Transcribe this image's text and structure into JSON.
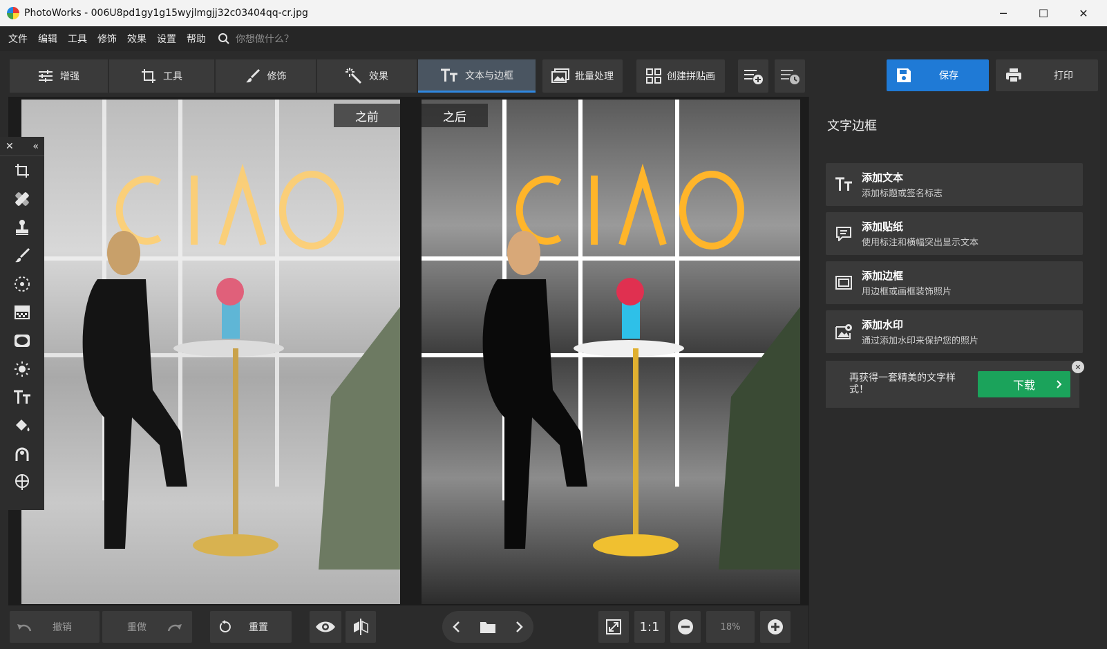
{
  "window": {
    "title": "PhotoWorks - 006U8pd1gy1g15wyjlmgjj32c03404qq-cr.jpg",
    "minimize": "─",
    "maximize": "☐",
    "close": "✕"
  },
  "menu": {
    "items": [
      "文件",
      "编辑",
      "工具",
      "修饰",
      "效果",
      "设置",
      "帮助"
    ],
    "search_placeholder": "你想做什么？"
  },
  "tabs": [
    {
      "label": "增强",
      "icon": "sliders-icon"
    },
    {
      "label": "工具",
      "icon": "crop-icon"
    },
    {
      "label": "修饰",
      "icon": "brush-icon"
    },
    {
      "label": "效果",
      "icon": "magic-wand-icon"
    },
    {
      "label": "文本与边框",
      "icon": "text-icon",
      "active": true
    }
  ],
  "toolbar": {
    "batch_label": "批量处理",
    "collage_label": "创建拼贴画",
    "save_label": "保存",
    "print_label": "打印"
  },
  "canvas": {
    "before_label": "之前",
    "after_label": "之后"
  },
  "tool_panel": {
    "close": "✕",
    "collapse": "«",
    "tools": [
      "crop-rotate-icon",
      "healing-icon",
      "clone-stamp-icon",
      "brush-icon",
      "radial-icon",
      "gradient-icon",
      "vignette-icon",
      "light-icon",
      "text-icon",
      "fill-icon",
      "curves-icon",
      "geo-icon"
    ]
  },
  "bottom": {
    "undo_label": "撤销",
    "redo_label": "重做",
    "reset_label": "重置",
    "one_to_one": "1:1",
    "zoom": "18%"
  },
  "right_panel": {
    "title": "文字边框",
    "cards": [
      {
        "title": "添加文本",
        "desc": "添加标题或签名标志",
        "icon": "text-icon"
      },
      {
        "title": "添加贴纸",
        "desc": "使用标注和横幅突出显示文本",
        "icon": "sticker-icon"
      },
      {
        "title": "添加边框",
        "desc": "用边框或画框装饰照片",
        "icon": "frame-icon"
      },
      {
        "title": "添加水印",
        "desc": "通过添加水印来保护您的照片",
        "icon": "watermark-icon"
      }
    ],
    "promo_text": "再获得一套精美的文字样式！",
    "promo_button": "下载",
    "promo_close": "✕"
  },
  "colors": {
    "accent": "#1f7ad6",
    "download": "#1ba35b",
    "background": "#2b2b2b"
  }
}
